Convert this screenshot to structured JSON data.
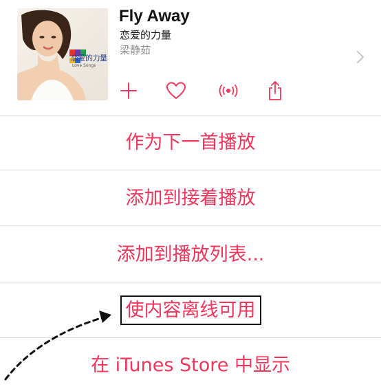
{
  "song": {
    "title": "Fly Away",
    "album": "恋爱的力量",
    "artist": "梁静茹",
    "art_caption": "恋爱的力量",
    "art_sub": "Love Songs"
  },
  "actions": [
    {
      "name": "add",
      "icon": "plus-icon"
    },
    {
      "name": "love",
      "icon": "heart-icon"
    },
    {
      "name": "radio",
      "icon": "broadcast-icon"
    },
    {
      "name": "share",
      "icon": "share-icon"
    }
  ],
  "menu": {
    "play_next": "作为下一首播放",
    "play_later": "添加到接着播放",
    "add_to_playlist": "添加到播放列表...",
    "make_offline": "使内容离线可用",
    "show_in_store": "在 iTunes Store 中显示"
  },
  "colors": {
    "accent": "#f2355b",
    "separator": "#dcdcdc",
    "secondary_text": "#8e8e93"
  }
}
